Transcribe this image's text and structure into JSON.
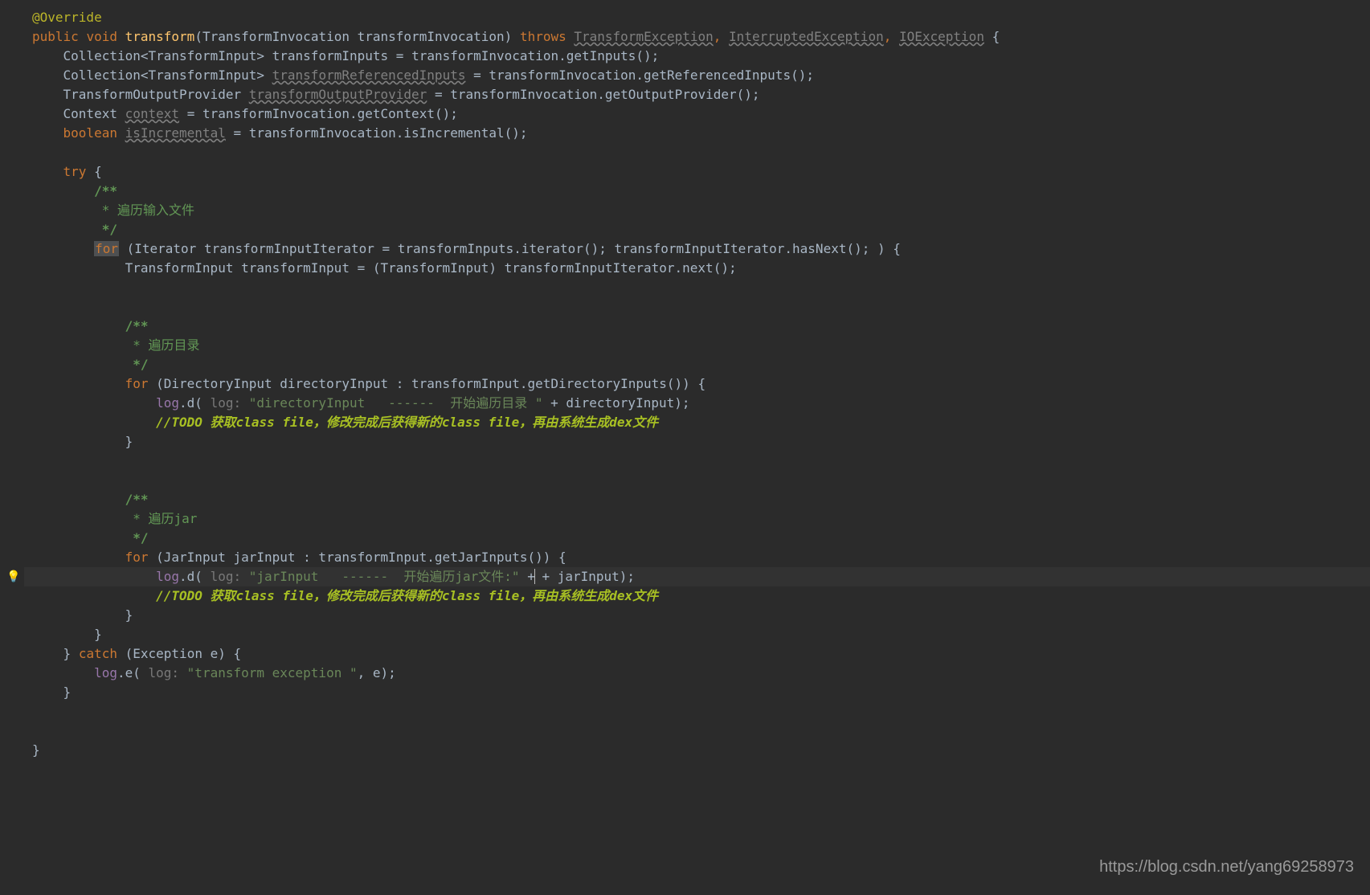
{
  "code": {
    "annotation": "@Override",
    "public": "public",
    "void": "void",
    "methodName": "transform",
    "paramType": "TransformInvocation",
    "paramName": "transformInvocation",
    "throws": "throws",
    "exc1": "TransformException",
    "exc2": "InterruptedException",
    "exc3": "IOException",
    "collType": "Collection",
    "transformInput": "TransformInput",
    "var1": "transformInputs",
    "getInputs": "transformInvocation.getInputs();",
    "var2": "transformReferencedInputs",
    "getRefInputs": "transformInvocation.getReferencedInputs();",
    "outProvType": "TransformOutputProvider",
    "var3": "transformOutputProvider",
    "getOutProv": "transformInvocation.getOutputProvider();",
    "contextType": "Context",
    "var4": "context",
    "getContext": "transformInvocation.getContext();",
    "boolType": "boolean",
    "var5": "isIncremental",
    "isIncremental": "transformInvocation.isIncremental();",
    "try": "try",
    "commentStart": "/**",
    "commentInputFiles": " * 遍历输入文件",
    "commentEnd": " */",
    "for": "for",
    "iteratorDecl": "(Iterator transformInputIterator = transformInputs.iterator(); transformInputIterator.hasNext(); ) {",
    "transformInputLine": "TransformInput transformInput = (TransformInput) transformInputIterator.next();",
    "commentDir": " * 遍历目录",
    "dirForDecl": "(DirectoryInput directoryInput : transformInput.getDirectoryInputs()) {",
    "logField": "log",
    "dMethod": ".d(",
    "logHint": " log: ",
    "dirLogStr": "\"directoryInput   ------  开始遍历目录 \"",
    "dirLogConcat": " + directoryInput);",
    "todoPrefix": "//",
    "todoText": "TODO 获取class file，修改完成后获得新的class file，再由系统生成dex文件",
    "commentJar": " * 遍历jar",
    "jarForDecl": "(JarInput jarInput : transformInput.getJarInputs()) {",
    "jarLogStr": "\"jarInput   ------  开始遍历jar文件:\"",
    "jarLogConcat": " + jarInput);",
    "catch": "catch",
    "catchDecl": "(Exception e) {",
    "eMethod": ".e(",
    "errLogStr": "\"transform exception \"",
    "errLogEnd": ", e);"
  },
  "watermark": "https://blog.csdn.net/yang69258973"
}
